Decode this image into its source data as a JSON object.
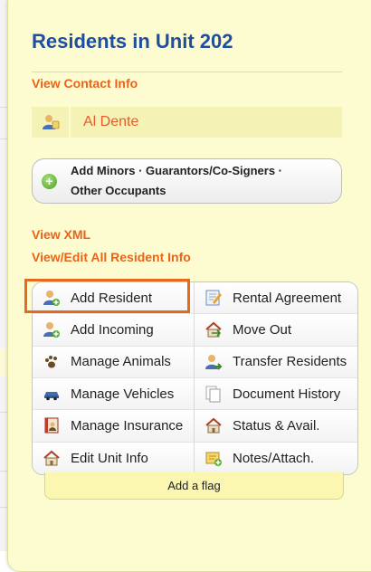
{
  "panel": {
    "title": "Residents in Unit 202",
    "view_contact_info": "View Contact Info",
    "resident_name": "Al Dente",
    "add_minors_label": "Add Minors · Guarantors/Co-Signers · Other Occupants",
    "view_xml": "View XML",
    "view_edit_all": "View/Edit All Resident Info"
  },
  "actions": {
    "add_resident": "Add Resident",
    "rental_agreement": "Rental Agreement",
    "add_incoming": "Add Incoming",
    "move_out": "Move Out",
    "manage_animals": "Manage Animals",
    "transfer_residents": "Transfer Residents",
    "manage_vehicles": "Manage Vehicles",
    "document_history": "Document History",
    "manage_insurance": "Manage Insurance",
    "status_avail": "Status & Avail.",
    "edit_unit_info": "Edit Unit Info",
    "notes_attach": "Notes/Attach."
  },
  "flag": {
    "label": "Add a flag"
  },
  "colors": {
    "title": "#1f4ea1",
    "link": "#e8641b",
    "panel_bg": "#fdfcd0",
    "highlight": "#e66a1c"
  }
}
